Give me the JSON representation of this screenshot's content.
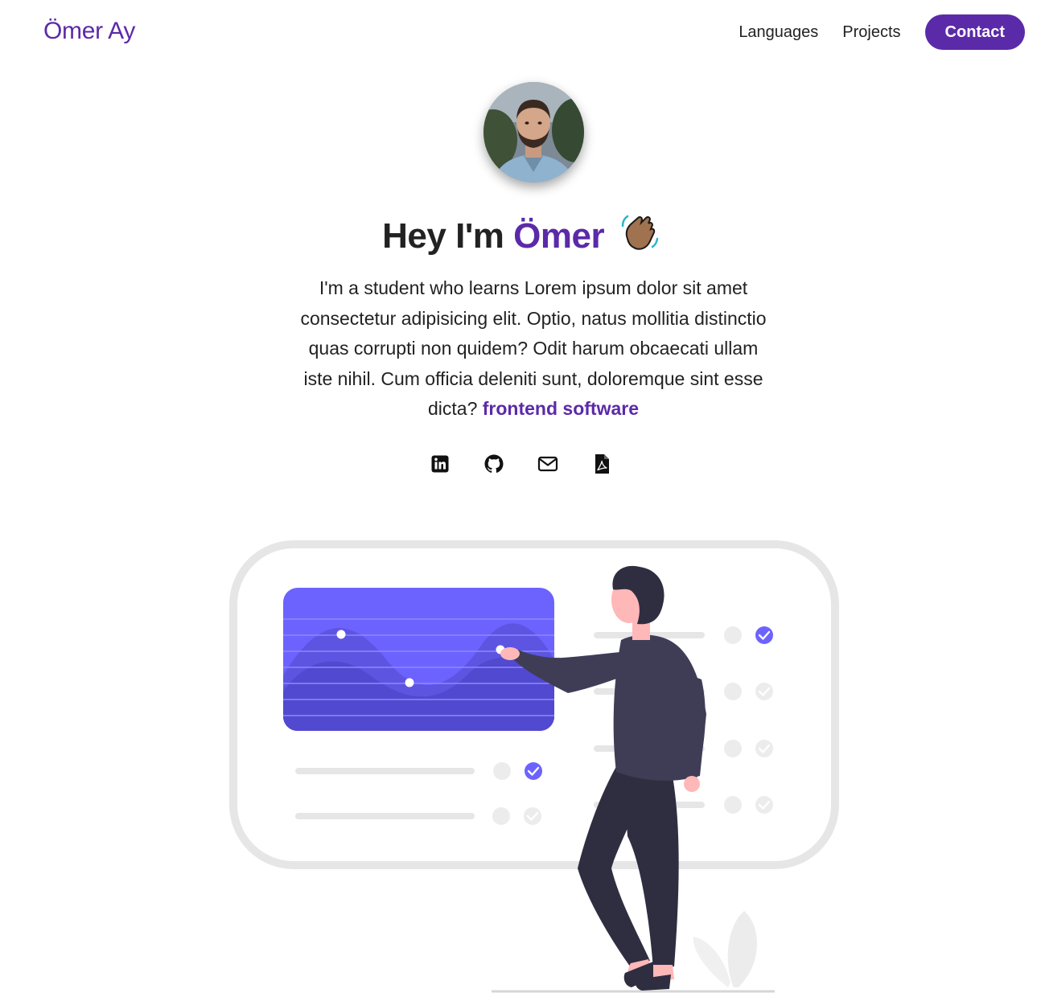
{
  "nav": {
    "brand": "Ömer Ay",
    "links": [
      {
        "label": "Languages"
      },
      {
        "label": "Projects"
      },
      {
        "label": "Contact"
      }
    ]
  },
  "hero": {
    "greeting": "Hey I'm ",
    "name": "Ömer",
    "wave_emoji": "waving-hand-emoji",
    "bio": "I'm a student who learns Lorem ipsum dolor sit amet consectetur adipisicing elit. Optio, natus mollitia distinctio quas corrupti non quidem? Odit harum obcaecati ullam iste nihil. Cum officia deleniti sunt, doloremque sint esse dicta? ",
    "bio_accent": "frontend software"
  },
  "socials": [
    {
      "icon": "linkedin-icon"
    },
    {
      "icon": "github-icon"
    },
    {
      "icon": "mail-icon"
    },
    {
      "icon": "pdf-icon"
    }
  ],
  "colors": {
    "accent": "#5b2aa8",
    "chart_fill": "#6c63ff"
  }
}
